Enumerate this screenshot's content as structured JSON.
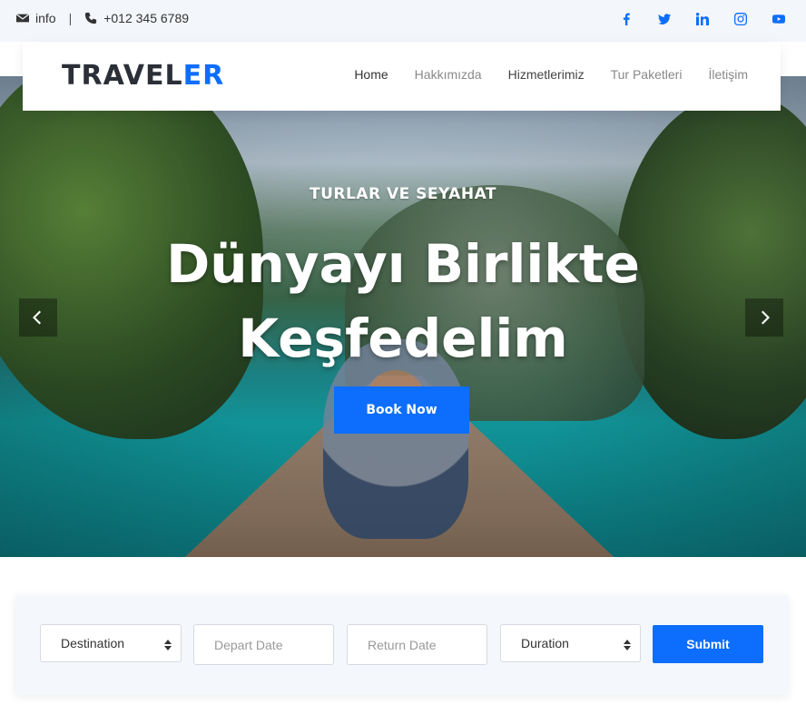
{
  "topbar": {
    "email_label": "info",
    "separator": "|",
    "phone": "+012 345 6789",
    "social": [
      "facebook-icon",
      "twitter-icon",
      "linkedin-icon",
      "instagram-icon",
      "youtube-icon"
    ],
    "accent": "#0d6efd"
  },
  "navbar": {
    "brand_part1": "TRAVEL",
    "brand_part2": "ER",
    "menu": [
      {
        "label": "Home"
      },
      {
        "label": "Hakkımızda"
      },
      {
        "label": "Hizmetlerimiz"
      },
      {
        "label": "Tur Paketleri"
      },
      {
        "label": "İletişim"
      }
    ]
  },
  "hero": {
    "subtitle": "TURLAR VE SEYAHAT",
    "title_line1": "Dünyayı Birlikte",
    "title_line2": "Keşfedelim",
    "cta": "Book Now"
  },
  "booking": {
    "destination": "Destination",
    "depart_placeholder": "Depart Date",
    "return_placeholder": "Return Date",
    "duration": "Duration",
    "submit": "Submit"
  },
  "colors": {
    "primary": "#0d6efd",
    "brand_dark": "#2b2f38",
    "topbar_bg": "#f3f6fa"
  }
}
